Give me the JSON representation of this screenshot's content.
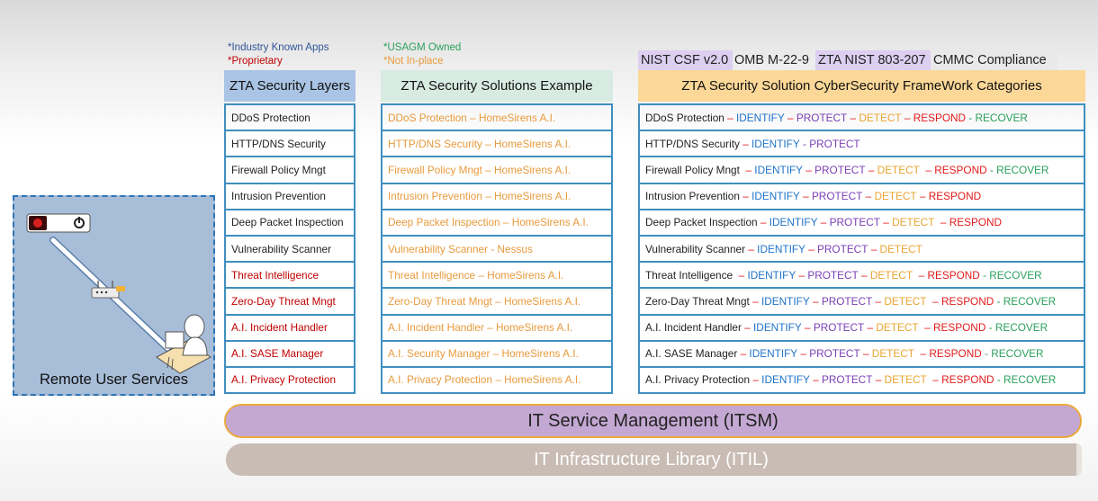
{
  "legend_left": {
    "industry": "*Industry Known Apps",
    "proprietary": "*Proprietary"
  },
  "legend_mid": {
    "owned": "*USAGM Owned",
    "not_in_place": "*Not In-place"
  },
  "frameworks": [
    "NIST CSF v2.0",
    "OMB M-22-9",
    "ZTA NIST 803-207",
    "CMMC Compliance"
  ],
  "headers": {
    "layers": "ZTA Security Layers",
    "solutions": "ZTA Security Solutions Example",
    "categories": "ZTA Security Solution CyberSecurity FrameWork Categories"
  },
  "remote_label": "Remote User Services",
  "layers": [
    {
      "label": "DDoS Protection",
      "kind": "industry"
    },
    {
      "label": "HTTP/DNS Security",
      "kind": "industry"
    },
    {
      "label": "Firewall Policy Mngt",
      "kind": "industry"
    },
    {
      "label": "Intrusion Prevention",
      "kind": "industry"
    },
    {
      "label": "Deep Packet Inspection",
      "kind": "industry"
    },
    {
      "label": "Vulnerability Scanner",
      "kind": "industry"
    },
    {
      "label": "Threat Intelligence",
      "kind": "proprietary"
    },
    {
      "label": "Zero-Day Threat Mngt",
      "kind": "proprietary"
    },
    {
      "label": "A.I. Incident Handler",
      "kind": "proprietary"
    },
    {
      "label": "A.I. SASE Manager",
      "kind": "proprietary"
    },
    {
      "label": "A.I. Privacy Protection",
      "kind": "proprietary"
    }
  ],
  "solutions": [
    "DDoS Protection – HomeSirens A.I.",
    "HTTP/DNS Security – HomeSirens A.I.",
    "Firewall Policy Mngt – HomeSirens A.I.",
    "Intrusion Prevention – HomeSirens A.I.",
    "Deep Packet Inspection – HomeSirens A.I.",
    "Vulnerability Scanner - Nessus",
    "Threat Intelligence – HomeSirens A.I.",
    "Zero-Day Threat Mngt – HomeSirens A.I.",
    "A.I. Incident Handler – HomeSirens A.I.",
    "A.I. Security Manager – HomeSirens A.I.",
    "A.I. Privacy Protection – HomeSirens A.I."
  ],
  "categories": [
    {
      "name": "DDoS Protection",
      "parts": [
        [
          "sep",
          " – "
        ],
        [
          "id",
          "IDENTIFY"
        ],
        [
          "sep",
          " – "
        ],
        [
          "pr",
          "PROTECT"
        ],
        [
          "sep",
          " – "
        ],
        [
          "de",
          "DETECT"
        ],
        [
          "sep",
          " – "
        ],
        [
          "rs",
          "RESPOND"
        ],
        [
          "gsep",
          " - "
        ],
        [
          "rc",
          "RECOVER"
        ]
      ]
    },
    {
      "name": "HTTP/DNS Security",
      "parts": [
        [
          "sep",
          " – "
        ],
        [
          "id",
          "IDENTIFY"
        ],
        [
          "psep",
          " - "
        ],
        [
          "pr",
          "PROTECT"
        ]
      ]
    },
    {
      "name": "Firewall Policy Mngt ",
      "parts": [
        [
          "sep",
          " – "
        ],
        [
          "id",
          "IDENTIFY"
        ],
        [
          "sep",
          " – "
        ],
        [
          "pr",
          "PROTECT"
        ],
        [
          "sep",
          " – "
        ],
        [
          "de",
          "DETECT"
        ],
        [
          "sep",
          "  – "
        ],
        [
          "rs",
          "RESPOND"
        ],
        [
          "gsep",
          " - "
        ],
        [
          "rc",
          "RECOVER"
        ]
      ]
    },
    {
      "name": "Intrusion Prevention",
      "parts": [
        [
          "sep",
          " – "
        ],
        [
          "id",
          "IDENTIFY"
        ],
        [
          "sep",
          " – "
        ],
        [
          "pr",
          "PROTECT"
        ],
        [
          "sep",
          " – "
        ],
        [
          "de",
          "DETECT"
        ],
        [
          "sep",
          " – "
        ],
        [
          "rs",
          "RESPOND"
        ]
      ]
    },
    {
      "name": "Deep Packet Inspection",
      "parts": [
        [
          "sep",
          " – "
        ],
        [
          "id",
          "IDENTIFY"
        ],
        [
          "sep",
          " – "
        ],
        [
          "pr",
          "PROTECT"
        ],
        [
          "sep",
          " – "
        ],
        [
          "de",
          "DETECT"
        ],
        [
          "sep",
          "  – "
        ],
        [
          "rs",
          "RESPOND"
        ]
      ]
    },
    {
      "name": "Vulnerability Scanner",
      "parts": [
        [
          "sep",
          " – "
        ],
        [
          "id",
          "IDENTIFY"
        ],
        [
          "sep",
          " – "
        ],
        [
          "pr",
          "PROTECT"
        ],
        [
          "sep",
          " – "
        ],
        [
          "de",
          "DETECT"
        ]
      ]
    },
    {
      "name": "Threat Intelligence ",
      "parts": [
        [
          "sep",
          " – "
        ],
        [
          "id",
          "IDENTIFY"
        ],
        [
          "sep",
          " – "
        ],
        [
          "pr",
          "PROTECT"
        ],
        [
          "sep",
          " – "
        ],
        [
          "de",
          "DETECT"
        ],
        [
          "sep",
          "  – "
        ],
        [
          "rs",
          "RESPOND"
        ],
        [
          "gsep",
          " - "
        ],
        [
          "rc",
          "RECOVER"
        ]
      ]
    },
    {
      "name": "Zero-Day Threat Mngt",
      "parts": [
        [
          "sep",
          " – "
        ],
        [
          "id",
          "IDENTIFY"
        ],
        [
          "sep",
          " – "
        ],
        [
          "pr",
          "PROTECT"
        ],
        [
          "sep",
          " – "
        ],
        [
          "de",
          "DETECT"
        ],
        [
          "sep",
          "  – "
        ],
        [
          "rs",
          "RESPOND"
        ],
        [
          "gsep",
          " - "
        ],
        [
          "rc",
          "RECOVER"
        ]
      ]
    },
    {
      "name": "A.I. Incident Handler",
      "parts": [
        [
          "sep",
          " – "
        ],
        [
          "id",
          "IDENTIFY"
        ],
        [
          "sep",
          " – "
        ],
        [
          "pr",
          "PROTECT"
        ],
        [
          "sep",
          " – "
        ],
        [
          "de",
          "DETECT"
        ],
        [
          "sep",
          "  – "
        ],
        [
          "rs",
          "RESPOND"
        ],
        [
          "gsep",
          " - "
        ],
        [
          "rc",
          "RECOVER"
        ]
      ]
    },
    {
      "name": "A.I. SASE Manager",
      "parts": [
        [
          "sep",
          " – "
        ],
        [
          "id",
          "IDENTIFY"
        ],
        [
          "sep",
          " – "
        ],
        [
          "pr",
          "PROTECT"
        ],
        [
          "sep",
          " – "
        ],
        [
          "de",
          "DETECT"
        ],
        [
          "sep",
          "  – "
        ],
        [
          "rs",
          "RESPOND"
        ],
        [
          "gsep",
          " - "
        ],
        [
          "rc",
          "RECOVER"
        ]
      ]
    },
    {
      "name": "A.I. Privacy Protection",
      "parts": [
        [
          "sep",
          " – "
        ],
        [
          "id",
          "IDENTIFY"
        ],
        [
          "sep",
          " – "
        ],
        [
          "pr",
          "PROTECT"
        ],
        [
          "sep",
          " – "
        ],
        [
          "de",
          "DETECT"
        ],
        [
          "sep",
          "  – "
        ],
        [
          "rs",
          "RESPOND"
        ],
        [
          "gsep",
          " - "
        ],
        [
          "rc",
          "RECOVER"
        ]
      ]
    }
  ],
  "bars": {
    "itsm": "IT Service Management (ITSM)",
    "itil": "IT Infrastructure Library (ITIL)"
  },
  "colors": {
    "industry": "#2f5597",
    "proprietary": "#c00000",
    "owned": "#2aa05b",
    "not_in_place": "#e89a3c",
    "identify": "#1f73c9",
    "protect": "#7a3fb5",
    "detect": "#e8a531",
    "respond": "#e31a1a",
    "recover": "#2aa05b",
    "border": "#3f8fbf",
    "header_layers": "#a9c4e4",
    "header_solutions": "#d7ebe2",
    "header_categories": "#fcd898",
    "framework_tag": "#dccff0",
    "itsm": "#c4a8d3",
    "itil": "#c9bcb4"
  }
}
